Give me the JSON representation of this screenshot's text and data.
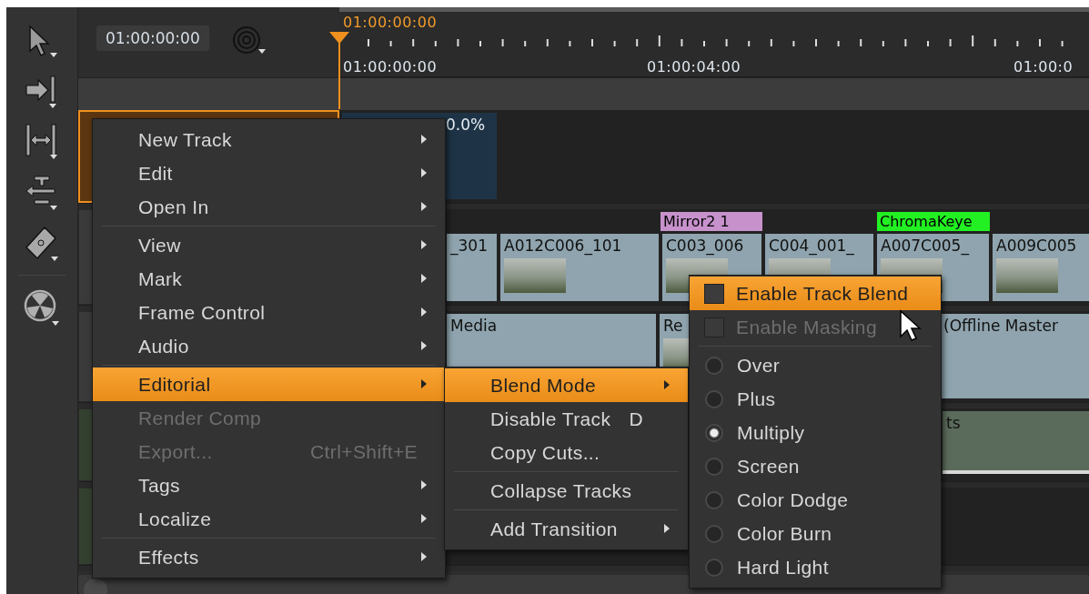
{
  "timecode": "01:00:00:00",
  "ruler": {
    "playhead": "01:00:00:00",
    "labels": [
      "01:00:00:00",
      "01:00:04:00",
      "01:00:0"
    ]
  },
  "tracks": [
    {
      "selected": true,
      "clips": [
        {
          "label": "0.0%"
        }
      ]
    },
    {
      "selected": false,
      "effects": [
        {
          "label": "Mirror2  1",
          "color": "#c792cc"
        },
        {
          "label": "ChromaKeye",
          "color": "#22f022"
        }
      ],
      "clips": [
        {
          "label": "_301",
          "thumbnail": false
        },
        {
          "label": "A012C006_101",
          "thumbnail": true
        },
        {
          "label": "C003_006",
          "thumbnail": true
        },
        {
          "label": "C004_001_",
          "thumbnail": true
        },
        {
          "label": "A007C005_",
          "thumbnail": true
        },
        {
          "label": "A009C005",
          "thumbnail": true
        }
      ]
    },
    {
      "selected": false,
      "clips": [
        {
          "label": "Media",
          "thumbnail": false
        },
        {
          "label": "Re",
          "thumbnail": true
        },
        {
          "label": "(Offline Master",
          "thumbnail": false
        }
      ]
    },
    {
      "selected": false,
      "clips": [
        {
          "label": "ts",
          "thumbnail": false
        }
      ]
    },
    {
      "selected": false
    }
  ],
  "menus": [
    {
      "items": [
        {
          "kind": "item",
          "label": "New Track",
          "submenu": true,
          "disabled": false,
          "selected": false
        },
        {
          "kind": "item",
          "label": "Edit",
          "submenu": true,
          "disabled": false,
          "selected": false
        },
        {
          "kind": "item",
          "label": "Open In",
          "submenu": true,
          "disabled": false,
          "selected": false
        },
        {
          "kind": "separator"
        },
        {
          "kind": "item",
          "label": "View",
          "submenu": true,
          "disabled": false,
          "selected": false
        },
        {
          "kind": "item",
          "label": "Mark",
          "submenu": true,
          "disabled": false,
          "selected": false
        },
        {
          "kind": "item",
          "label": "Frame Control",
          "submenu": true,
          "disabled": false,
          "selected": false
        },
        {
          "kind": "item",
          "label": "Audio",
          "submenu": true,
          "disabled": false,
          "selected": false
        },
        {
          "kind": "separator"
        },
        {
          "kind": "item",
          "label": "Editorial",
          "submenu": true,
          "disabled": false,
          "selected": true
        },
        {
          "kind": "item",
          "label": "Render Comp",
          "submenu": false,
          "disabled": true,
          "selected": false
        },
        {
          "kind": "item",
          "label": "Export...",
          "shortcut": "Ctrl+Shift+E",
          "submenu": false,
          "disabled": true,
          "selected": false
        },
        {
          "kind": "item",
          "label": "Tags",
          "submenu": true,
          "disabled": false,
          "selected": false
        },
        {
          "kind": "item",
          "label": "Localize",
          "submenu": true,
          "disabled": false,
          "selected": false
        },
        {
          "kind": "separator"
        },
        {
          "kind": "item",
          "label": "Effects",
          "submenu": true,
          "disabled": false,
          "selected": false
        }
      ]
    },
    {
      "items": [
        {
          "kind": "item",
          "label": "Blend Mode",
          "submenu": true,
          "disabled": false,
          "selected": true
        },
        {
          "kind": "item",
          "label": "Disable Track",
          "shortcut": "D",
          "submenu": false,
          "disabled": false,
          "selected": false
        },
        {
          "kind": "item",
          "label": "Copy Cuts...",
          "submenu": false,
          "disabled": false,
          "selected": false
        },
        {
          "kind": "separator"
        },
        {
          "kind": "item",
          "label": "Collapse Tracks",
          "submenu": false,
          "disabled": false,
          "selected": false
        },
        {
          "kind": "separator"
        },
        {
          "kind": "item",
          "label": "Add Transition",
          "submenu": true,
          "disabled": false,
          "selected": false
        }
      ]
    },
    {
      "items": [
        {
          "kind": "checkbox",
          "label": "Enable Track Blend",
          "checked": false,
          "disabled": false,
          "selected": true
        },
        {
          "kind": "checkbox",
          "label": "Enable Masking",
          "checked": false,
          "disabled": true,
          "selected": false
        },
        {
          "kind": "separator"
        },
        {
          "kind": "radio",
          "label": "Over",
          "checked": false,
          "disabled": false,
          "selected": false
        },
        {
          "kind": "radio",
          "label": "Plus",
          "checked": false,
          "disabled": false,
          "selected": false
        },
        {
          "kind": "radio",
          "label": "Multiply",
          "checked": true,
          "disabled": false,
          "selected": false
        },
        {
          "kind": "radio",
          "label": "Screen",
          "checked": false,
          "disabled": false,
          "selected": false
        },
        {
          "kind": "radio",
          "label": "Color Dodge",
          "checked": false,
          "disabled": false,
          "selected": false
        },
        {
          "kind": "radio",
          "label": "Color Burn",
          "checked": false,
          "disabled": false,
          "selected": false
        },
        {
          "kind": "radio",
          "label": "Hard Light",
          "checked": false,
          "disabled": false,
          "selected": false
        }
      ]
    }
  ]
}
